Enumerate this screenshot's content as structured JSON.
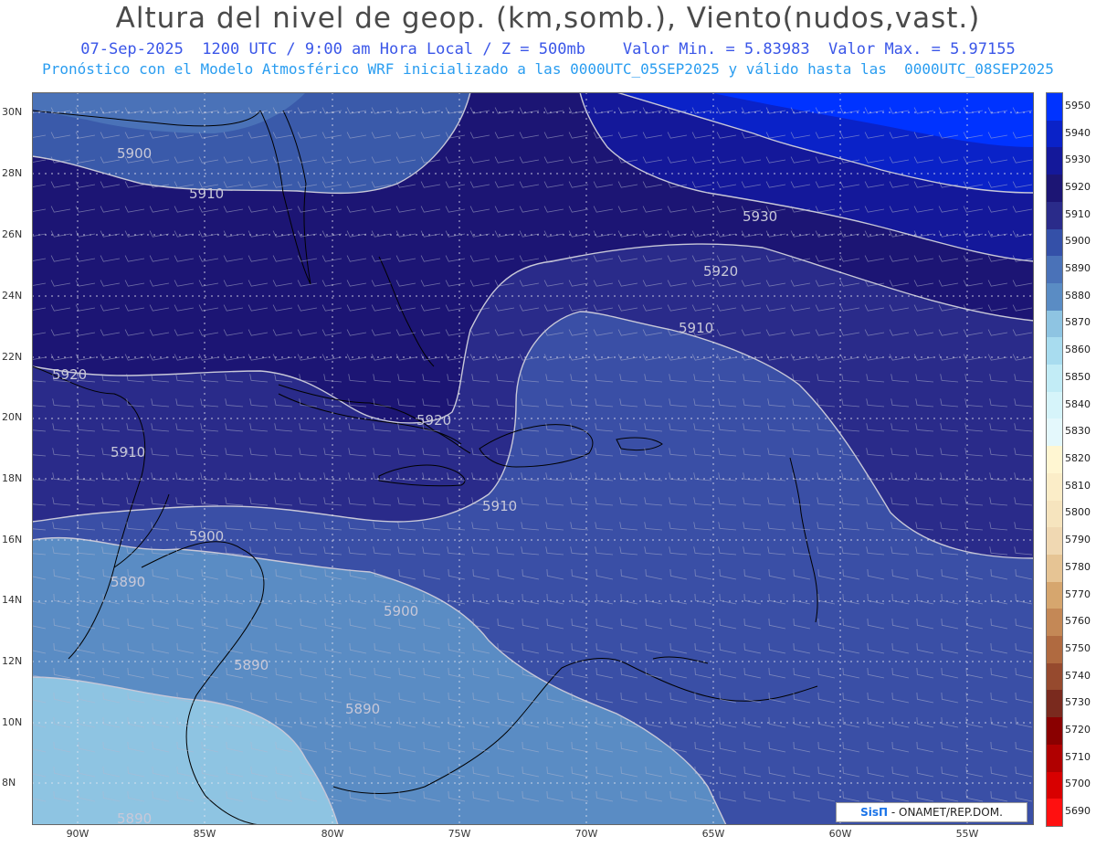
{
  "header": {
    "title": "Altura del nivel de geop. (km,somb.), Viento(nudos,vast.)",
    "line1": "07-Sep-2025  1200 UTC / 9:00 am Hora Local / Z = 500mb    Valor Min. = 5.83983  Valor Max. = 5.97155",
    "line2": "Pronóstico con el Modelo Atmosférico WRF inicializado a las 0000UTC_05SEP2025 y válido hasta las  0000UTC_08SEP2025"
  },
  "map": {
    "lat_labels": [
      "30N",
      "28N",
      "26N",
      "24N",
      "22N",
      "20N",
      "18N",
      "16N",
      "14N",
      "12N",
      "10N",
      "8N"
    ],
    "lon_labels": [
      "90W",
      "85W",
      "80W",
      "75W",
      "70W",
      "65W",
      "60W",
      "55W"
    ],
    "contour_labels": [
      {
        "text": "5900"
      },
      {
        "text": "5910"
      },
      {
        "text": "5930"
      },
      {
        "text": "5920"
      },
      {
        "text": "5910"
      },
      {
        "text": "5920"
      },
      {
        "text": "5920"
      },
      {
        "text": "5910"
      },
      {
        "text": "5910"
      },
      {
        "text": "5900"
      },
      {
        "text": "5890"
      },
      {
        "text": "5900"
      },
      {
        "text": "5890"
      },
      {
        "text": "5890"
      },
      {
        "text": "5890"
      }
    ]
  },
  "scale": {
    "labels": [
      "5950",
      "5940",
      "5930",
      "5920",
      "5910",
      "5900",
      "5890",
      "5880",
      "5870",
      "5860",
      "5850",
      "5840",
      "5830",
      "5820",
      "5810",
      "5800",
      "5790",
      "5780",
      "5770",
      "5760",
      "5750",
      "5740",
      "5730",
      "5720",
      "5710",
      "5700",
      "5690"
    ],
    "colors": [
      "#0033ff",
      "#0a22c8",
      "#14189a",
      "#1c1574",
      "#2a2b8a",
      "#3450a8",
      "#4a72b8",
      "#5a8cc4",
      "#8ec4e2",
      "#a8dcef",
      "#c2ecf6",
      "#d6f4fa",
      "#e4f8fc",
      "#fff6d2",
      "#fbedc8",
      "#f6e4be",
      "#f0d8b2",
      "#e6c494",
      "#d6a66e",
      "#c48856",
      "#b06a40",
      "#964a2e",
      "#7a2a1e",
      "#8a0000",
      "#b00000",
      "#d80000",
      "#ff1010"
    ]
  },
  "credit": {
    "brand": "SisΠ",
    "text": " - ONAMET/REP.DOM."
  }
}
